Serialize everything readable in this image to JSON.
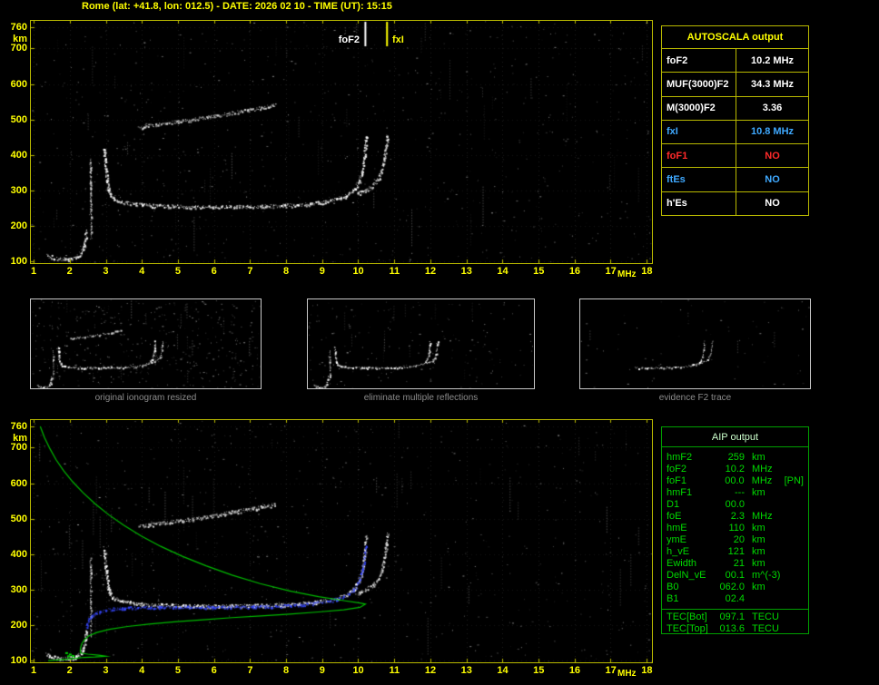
{
  "header": {
    "title": "Rome (lat: +41.8, lon: 012.5) - DATE: 2026 02 10 - TIME (UT): 15:15"
  },
  "axes": {
    "y_ticks": [
      760,
      700,
      600,
      500,
      400,
      300,
      200,
      100
    ],
    "y_unit": "km",
    "x_ticks": [
      1,
      2,
      3,
      4,
      5,
      6,
      7,
      8,
      9,
      10,
      11,
      12,
      13,
      14,
      15,
      16,
      17,
      18
    ],
    "x_unit": "MHz"
  },
  "autoscala": {
    "header": "AUTOSCALA output",
    "rows": [
      {
        "label": "foF2",
        "value": "10.2 MHz",
        "color": "#ffffff"
      },
      {
        "label": "MUF(3000)F2",
        "value": "34.3 MHz",
        "color": "#ffffff"
      },
      {
        "label": "M(3000)F2",
        "value": "3.36",
        "color": "#ffffff"
      },
      {
        "label": "fxI",
        "value": "10.8 MHz",
        "color": "#3fa9ff"
      },
      {
        "label": "foF1",
        "value": "NO",
        "color": "#ff2a2a"
      },
      {
        "label": "ftEs",
        "value": "NO",
        "color": "#3fa9ff"
      },
      {
        "label": "h'Es",
        "value": "NO",
        "color": "#ffffff"
      }
    ]
  },
  "aip": {
    "header": "AIP output",
    "rows": [
      {
        "name": "hmF2",
        "value": "259",
        "unit": "km",
        "extra": ""
      },
      {
        "name": "foF2",
        "value": "10.2",
        "unit": "MHz",
        "extra": ""
      },
      {
        "name": "foF1",
        "value": "00.0",
        "unit": "MHz",
        "extra": "[PN]"
      },
      {
        "name": "hmF1",
        "value": "---",
        "unit": "km",
        "extra": ""
      },
      {
        "name": "D1",
        "value": "00.0",
        "unit": "",
        "extra": ""
      },
      {
        "name": "foE",
        "value": "2.3",
        "unit": "MHz",
        "extra": ""
      },
      {
        "name": "hmE",
        "value": "110",
        "unit": "km",
        "extra": ""
      },
      {
        "name": "ymE",
        "value": "20",
        "unit": "km",
        "extra": ""
      },
      {
        "name": "h_vE",
        "value": "121",
        "unit": "km",
        "extra": ""
      },
      {
        "name": "Ewidth",
        "value": "21",
        "unit": "km",
        "extra": ""
      },
      {
        "name": "DelN_vE",
        "value": "00.1",
        "unit": "m^(-3)",
        "extra": ""
      },
      {
        "name": "B0",
        "value": "062.0",
        "unit": "km",
        "extra": ""
      },
      {
        "name": "B1",
        "value": "02.4",
        "unit": "",
        "extra": ""
      },
      {
        "name": "TEC[Bot]",
        "value": "097.1",
        "unit": "TECU",
        "extra": "",
        "sep": true
      },
      {
        "name": "TEC[Top]",
        "value": "013.6",
        "unit": "TECU",
        "extra": ""
      }
    ]
  },
  "thumbnails": [
    {
      "caption": "original ionogram resized",
      "noise": 0.6,
      "series": [
        {
          "name": "f2_ordinary"
        },
        {
          "name": "f2_extraordinary"
        },
        {
          "name": "second_hop"
        },
        {
          "name": "e_trace"
        },
        {
          "name": "cusp"
        }
      ]
    },
    {
      "caption": "eliminate multiple reflections",
      "noise": 0.25,
      "series": [
        {
          "name": "f2_ordinary"
        },
        {
          "name": "f2_extraordinary"
        },
        {
          "name": "e_trace"
        },
        {
          "name": "cusp"
        }
      ]
    },
    {
      "caption": "evidence F2 trace",
      "noise": 0.1,
      "series": [
        {
          "name": "f2_ordinary",
          "min_f": 4.5
        },
        {
          "name": "f2_extraordinary"
        }
      ]
    }
  ],
  "chart_data": [
    {
      "id": "top-ionogram",
      "type": "scatter",
      "xlabel": "MHz",
      "ylabel": "km",
      "x_range": [
        0.92,
        18.15
      ],
      "y_range": [
        95,
        778
      ],
      "x_ticks": [
        1,
        2,
        3,
        4,
        5,
        6,
        7,
        8,
        9,
        10,
        11,
        12,
        13,
        14,
        15,
        16,
        17,
        18
      ],
      "y_gridlines": [
        100,
        200,
        300,
        400,
        500,
        600,
        700,
        760
      ],
      "grid": true,
      "noise": 1.0,
      "markers": [
        {
          "label": "foF2",
          "f": 10.2,
          "color": "#ffffff"
        },
        {
          "label": "fxI",
          "f": 10.8,
          "color": "#ffff00"
        }
      ],
      "series": [
        {
          "name": "f2_ordinary",
          "label": "F2 ordinary-ray trace",
          "color": "#ffffff",
          "style": "scatter",
          "points": [
            [
              2.95,
              418
            ],
            [
              2.97,
              386
            ],
            [
              3.0,
              352
            ],
            [
              3.03,
              325
            ],
            [
              3.07,
              302
            ],
            [
              3.14,
              286
            ],
            [
              3.25,
              275
            ],
            [
              3.45,
              267
            ],
            [
              3.75,
              262
            ],
            [
              4.2,
              258
            ],
            [
              5.0,
              255
            ],
            [
              6.0,
              254
            ],
            [
              7.0,
              255
            ],
            [
              8.0,
              258
            ],
            [
              8.7,
              263
            ],
            [
              9.2,
              271
            ],
            [
              9.6,
              283
            ],
            [
              9.85,
              300
            ],
            [
              10.0,
              322
            ],
            [
              10.1,
              352
            ],
            [
              10.16,
              392
            ],
            [
              10.2,
              432
            ],
            [
              10.21,
              456
            ]
          ]
        },
        {
          "name": "f2_extraordinary",
          "label": "F2 extraordinary-ray trace",
          "color": "#e8e8e8",
          "style": "scatter",
          "points": [
            [
              9.95,
              291
            ],
            [
              10.2,
              300
            ],
            [
              10.4,
              313
            ],
            [
              10.55,
              331
            ],
            [
              10.65,
              356
            ],
            [
              10.72,
              390
            ],
            [
              10.77,
              428
            ],
            [
              10.8,
              458
            ]
          ]
        },
        {
          "name": "second_hop",
          "label": "second-hop multiple reflection",
          "color": "#d8d8d8",
          "style": "scatter",
          "points": [
            [
              3.9,
              478
            ],
            [
              4.4,
              486
            ],
            [
              4.9,
              493
            ],
            [
              5.4,
              500
            ],
            [
              5.9,
              508
            ],
            [
              6.4,
              517
            ],
            [
              6.9,
              526
            ],
            [
              7.4,
              535
            ],
            [
              7.7,
              541
            ]
          ]
        },
        {
          "name": "e_trace",
          "label": "E / Es region echoes",
          "color": "#ffffff",
          "style": "scatter",
          "points": [
            [
              1.35,
              120
            ],
            [
              1.5,
              112
            ],
            [
              1.7,
              107
            ],
            [
              1.95,
              106
            ],
            [
              2.15,
              110
            ],
            [
              2.3,
              121
            ],
            [
              2.38,
              139
            ],
            [
              2.42,
              162
            ],
            [
              2.45,
              188
            ]
          ]
        },
        {
          "name": "cusp",
          "label": "vertical spread near 2.6 MHz",
          "color": "#e0e0e0",
          "style": "scatter",
          "jitter": 1.5,
          "density": 1.0,
          "points": [
            [
              2.56,
              388
            ],
            [
              2.57,
              300
            ],
            [
              2.58,
              230
            ],
            [
              2.58,
              168
            ]
          ]
        }
      ]
    },
    {
      "id": "bottom-ionogram",
      "type": "scatter",
      "xlabel": "MHz",
      "ylabel": "km",
      "x_range": [
        0.92,
        18.15
      ],
      "y_range": [
        95,
        778
      ],
      "x_ticks": [
        1,
        2,
        3,
        4,
        5,
        6,
        7,
        8,
        9,
        10,
        11,
        12,
        13,
        14,
        15,
        16,
        17,
        18
      ],
      "y_gridlines": [
        100,
        200,
        300,
        400,
        500,
        600,
        700,
        760
      ],
      "grid": true,
      "noise": 0.9,
      "markers": [],
      "series": [
        {
          "name": "f2_ordinary",
          "label": "F2 ordinary-ray trace",
          "color": "#ffffff",
          "style": "scatter",
          "points": [
            [
              2.95,
              418
            ],
            [
              2.97,
              386
            ],
            [
              3.0,
              352
            ],
            [
              3.03,
              325
            ],
            [
              3.07,
              302
            ],
            [
              3.14,
              286
            ],
            [
              3.25,
              275
            ],
            [
              3.45,
              267
            ],
            [
              3.75,
              262
            ],
            [
              4.2,
              258
            ],
            [
              5.0,
              255
            ],
            [
              6.0,
              254
            ],
            [
              7.0,
              255
            ],
            [
              8.0,
              258
            ],
            [
              8.7,
              263
            ],
            [
              9.2,
              271
            ],
            [
              9.6,
              283
            ],
            [
              9.85,
              300
            ],
            [
              10.0,
              322
            ],
            [
              10.1,
              352
            ],
            [
              10.16,
              392
            ],
            [
              10.2,
              432
            ],
            [
              10.21,
              456
            ]
          ]
        },
        {
          "name": "f2_extraordinary",
          "label": "F2 extraordinary-ray trace",
          "color": "#e8e8e8",
          "style": "scatter",
          "points": [
            [
              9.95,
              291
            ],
            [
              10.2,
              300
            ],
            [
              10.4,
              313
            ],
            [
              10.55,
              331
            ],
            [
              10.65,
              356
            ],
            [
              10.72,
              390
            ],
            [
              10.77,
              428
            ],
            [
              10.8,
              458
            ]
          ]
        },
        {
          "name": "second_hop",
          "label": "second-hop multiple reflection",
          "color": "#d8d8d8",
          "style": "scatter",
          "points": [
            [
              3.9,
              478
            ],
            [
              4.4,
              486
            ],
            [
              4.9,
              493
            ],
            [
              5.4,
              500
            ],
            [
              5.9,
              508
            ],
            [
              6.4,
              517
            ],
            [
              6.9,
              526
            ],
            [
              7.4,
              535
            ],
            [
              7.7,
              541
            ]
          ]
        },
        {
          "name": "e_trace",
          "label": "E / Es region echoes",
          "color": "#ffffff",
          "style": "scatter",
          "points": [
            [
              1.35,
              120
            ],
            [
              1.5,
              112
            ],
            [
              1.7,
              107
            ],
            [
              1.95,
              106
            ],
            [
              2.15,
              110
            ],
            [
              2.3,
              121
            ],
            [
              2.38,
              139
            ],
            [
              2.42,
              162
            ],
            [
              2.45,
              188
            ]
          ]
        },
        {
          "name": "cusp",
          "label": "vertical spread near 2.6 MHz",
          "color": "#e0e0e0",
          "style": "scatter",
          "jitter": 1.5,
          "density": 1.0,
          "points": [
            [
              2.56,
              388
            ],
            [
              2.57,
              300
            ],
            [
              2.58,
              230
            ],
            [
              2.58,
              168
            ]
          ]
        },
        {
          "name": "restored_trace",
          "label": "restored / adjusted trace",
          "color": "#3748ff",
          "style": "scatter",
          "jitter": 2,
          "density": 1.3,
          "points": [
            [
              2.45,
              196
            ],
            [
              2.5,
              214
            ],
            [
              2.62,
              228
            ],
            [
              2.82,
              238
            ],
            [
              3.1,
              245
            ],
            [
              3.5,
              249
            ],
            [
              4.2,
              251
            ],
            [
              5.0,
              251
            ],
            [
              6.0,
              251
            ],
            [
              7.0,
              252
            ],
            [
              8.0,
              255
            ],
            [
              8.7,
              261
            ],
            [
              9.2,
              269
            ],
            [
              9.6,
              281
            ],
            [
              9.85,
              297
            ],
            [
              10.0,
              319
            ],
            [
              10.1,
              349
            ],
            [
              10.16,
              388
            ],
            [
              10.2,
              425
            ]
          ]
        },
        {
          "name": "density_profile",
          "label": "electron density profile (hmF2 259 km, foF2 10.2 MHz, foE 2.3 MHz)",
          "color": "#00bb00",
          "style": "line",
          "points": [
            [
              1.18,
              760
            ],
            [
              1.3,
              728
            ],
            [
              1.45,
              697
            ],
            [
              1.62,
              666
            ],
            [
              1.83,
              635
            ],
            [
              2.08,
              604
            ],
            [
              2.37,
              573
            ],
            [
              2.7,
              542
            ],
            [
              3.08,
              511
            ],
            [
              3.5,
              481
            ],
            [
              3.98,
              451
            ],
            [
              4.52,
              422
            ],
            [
              5.12,
              394
            ],
            [
              5.78,
              367
            ],
            [
              6.5,
              341
            ],
            [
              7.28,
              317
            ],
            [
              8.1,
              296
            ],
            [
              8.9,
              280
            ],
            [
              9.6,
              269
            ],
            [
              10.05,
              262
            ],
            [
              10.2,
              259
            ],
            [
              10.05,
              250
            ],
            [
              9.6,
              243
            ],
            [
              8.9,
              237
            ],
            [
              8.1,
              231
            ],
            [
              7.3,
              226
            ],
            [
              6.5,
              221
            ],
            [
              5.7,
              215
            ],
            [
              4.9,
              209
            ],
            [
              4.2,
              203
            ],
            [
              3.6,
              196
            ],
            [
              3.1,
              188
            ],
            [
              2.75,
              179
            ],
            [
              2.52,
              169
            ],
            [
              2.4,
              158
            ],
            [
              2.33,
              147
            ],
            [
              2.3,
              136
            ],
            [
              2.29,
              127
            ],
            [
              2.3,
              121
            ],
            [
              2.5,
              118
            ],
            [
              2.8,
              115
            ],
            [
              3.0,
              112
            ],
            [
              2.7,
              110
            ],
            [
              2.4,
              109
            ],
            [
              2.15,
              106
            ],
            [
              1.85,
              103
            ],
            [
              1.6,
              101
            ],
            [
              1.4,
              100
            ]
          ]
        },
        {
          "name": "es_mark",
          "label": "E layer mark",
          "color": "#00e000",
          "style": "blob",
          "points": [
            [
              1.9,
              121
            ],
            [
              2.0,
              117
            ],
            [
              2.08,
              113
            ],
            [
              1.95,
              112
            ]
          ]
        }
      ]
    }
  ]
}
